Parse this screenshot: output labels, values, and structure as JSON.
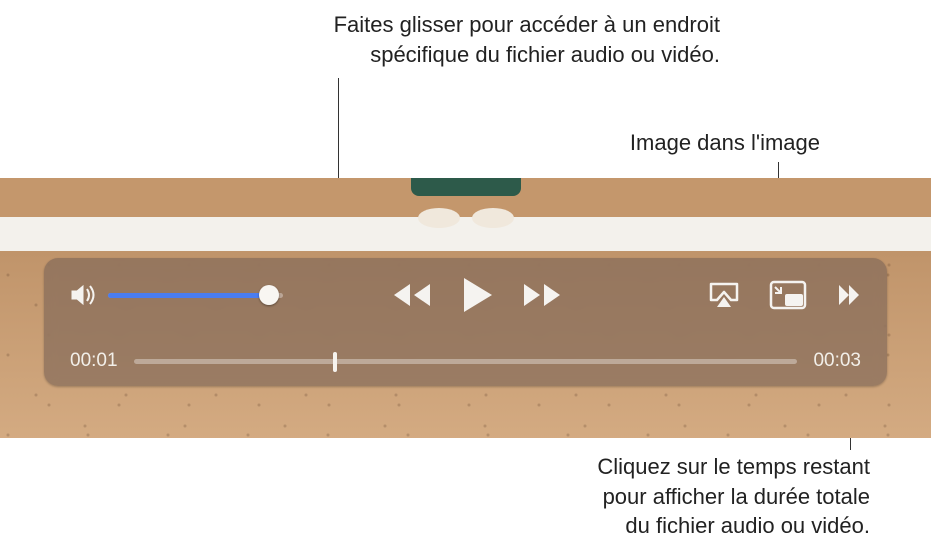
{
  "callouts": {
    "scrub": "Faites glisser pour accéder à un endroit\nspécifique du fichier audio ou vidéo.",
    "pip": "Image dans l'image",
    "remaining": "Cliquez sur le temps restant\npour afficher la durée totale\ndu fichier audio ou vidéo."
  },
  "player": {
    "volume_percent": 88,
    "current_time": "00:01",
    "remaining_time": "00:03",
    "scrub_percent": 30
  },
  "icons": {
    "volume": "volume-icon",
    "rewind": "rewind-icon",
    "play": "play-icon",
    "forward": "fast-forward-icon",
    "airplay": "airplay-icon",
    "pip": "picture-in-picture-icon",
    "expand": "expand-icon"
  }
}
